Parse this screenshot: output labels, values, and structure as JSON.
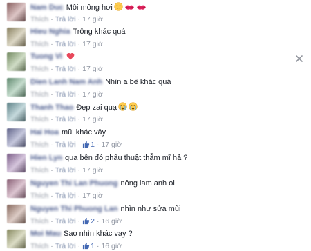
{
  "comments": [
    {
      "name": "Nam Duc",
      "text": "Môi mông hơi",
      "emojis": [
        "confused",
        "kiss",
        "kiss"
      ],
      "actions": {
        "like": "Thích",
        "reply": "Trả lời"
      },
      "time": "17 giờ",
      "likes": ""
    },
    {
      "name": "Hieu Nghia",
      "text": "Trông khác quá",
      "emojis": [],
      "actions": {
        "like": "Thích",
        "reply": "Trả lời"
      },
      "time": "17 giờ",
      "likes": ""
    },
    {
      "name": "Tuong Vi",
      "text": "",
      "emojis": [
        "heart"
      ],
      "actions": {
        "like": "Thích",
        "reply": "Trả lời"
      },
      "time": "17 giờ",
      "likes": ""
    },
    {
      "name": "Dien Lanh Nam Anh",
      "text": "Nhìn a bê khác quá",
      "emojis": [],
      "actions": {
        "like": "Thích",
        "reply": "Trả lời"
      },
      "time": "17 giờ",
      "likes": ""
    },
    {
      "name": "Thanh Thao",
      "text": "Đẹp zai quạ",
      "emojis": [
        "cry",
        "cry"
      ],
      "actions": {
        "like": "Thích",
        "reply": "Trả lời"
      },
      "time": "17 giờ",
      "likes": ""
    },
    {
      "name": "Hai Hoa",
      "text": "mũi khác vậy",
      "emojis": [],
      "actions": {
        "like": "Thích",
        "reply": "Trả lời"
      },
      "time": "17 giờ",
      "likes": "1"
    },
    {
      "name": "Hien Lyn",
      "text": "qua bên đó phẩu thuật thẫm mĩ hả ?",
      "emojis": [],
      "actions": {
        "like": "Thích",
        "reply": "Trả lời"
      },
      "time": "17 giờ",
      "likes": ""
    },
    {
      "name": "Nguyen Thi Lan Phuong",
      "text": "nông lam anh oi",
      "emojis": [],
      "actions": {
        "like": "Thích",
        "reply": "Trả lời"
      },
      "time": "17 giờ",
      "likes": ""
    },
    {
      "name": "Nguyen Thi Phuong Lan",
      "text": "nhìn như sửa mũi",
      "emojis": [],
      "actions": {
        "like": "Thích",
        "reply": "Trả lời"
      },
      "time": "16 giờ",
      "likes": "2"
    },
    {
      "name": "Moi Mau",
      "text": "Sao nhìn khác vay ?",
      "emojis": [],
      "actions": {
        "like": "Thích",
        "reply": "Trả lời"
      },
      "time": "16 giờ",
      "likes": "1"
    }
  ],
  "colors": {
    "link": "#4a5a8c",
    "meta": "#9197a3",
    "like": "#4267b2",
    "kiss": "#e0245e",
    "heart": "#e8485b",
    "emoji_face": "#ffcc4d"
  }
}
